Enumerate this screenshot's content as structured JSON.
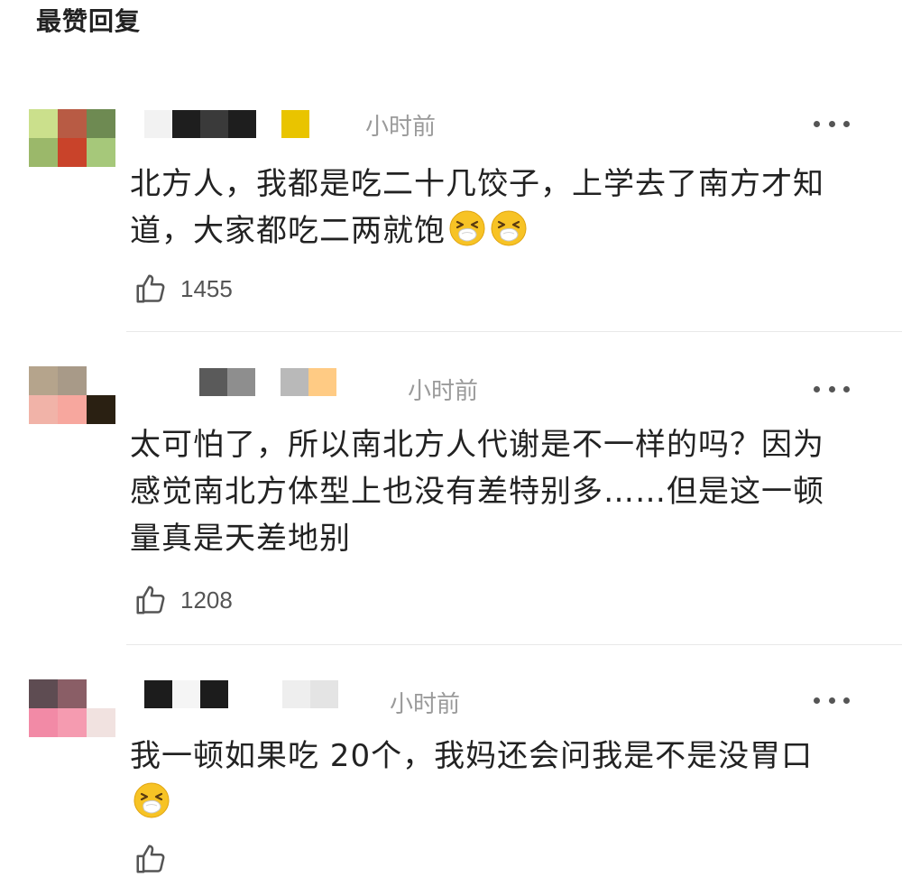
{
  "header": {
    "title": "最赞回复"
  },
  "comments": [
    {
      "timestamp": "小时前",
      "content": "北方人，我都是吃二十几饺子，上学去了南方才知道，大家都吃二两就饱",
      "emoji": [
        "sneezing-face-icon",
        "sneezing-face-icon"
      ],
      "likes": "1455",
      "avatar_colors": [
        "#cbe08c",
        "#b85b44",
        "#6e8a52",
        "#9bb86a",
        "#c9432a",
        "#a6c87a"
      ],
      "name_colors": [
        "#f2f2f2",
        "#1e1e1e",
        "#3a3a3a",
        "#1e1e1e",
        "#ffffff",
        "#e9c400"
      ]
    },
    {
      "timestamp": "小时前",
      "content": "太可怕了，所以南北方人代谢是不一样的吗？因为感觉南北方体型上也没有差特别多……但是这一顿量真是天差地别",
      "emoji": [],
      "likes": "1208",
      "avatar_colors": [
        "#b5a48c",
        "#a89a88",
        "#ffffff",
        "#f1b3a8",
        "#f7a79e",
        "#2a2012"
      ],
      "name_colors": [
        "#ffffff",
        "#5a5a5a",
        "#8e8e8e",
        "#ffffff",
        "#b9b9b9",
        "#ffcb84"
      ]
    },
    {
      "timestamp": "小时前",
      "content": "我一顿如果吃 20个，我妈还会问我是不是没胃口",
      "emoji": [
        "sneezing-face-icon"
      ],
      "likes": "",
      "avatar_colors": [
        "#5e4c52",
        "#8a5e66",
        "#ffffff",
        "#f28aa6",
        "#f59bb0",
        "#f1e2e0"
      ],
      "name_colors": [
        "#1c1c1c",
        "#f5f5f5",
        "#1c1c1c",
        "#ffffff",
        "#eeeeee",
        "#e4e4e4"
      ]
    }
  ],
  "colors": {
    "text": "#222222",
    "meta": "#9a9a9a",
    "divider": "#e8e8e8"
  }
}
